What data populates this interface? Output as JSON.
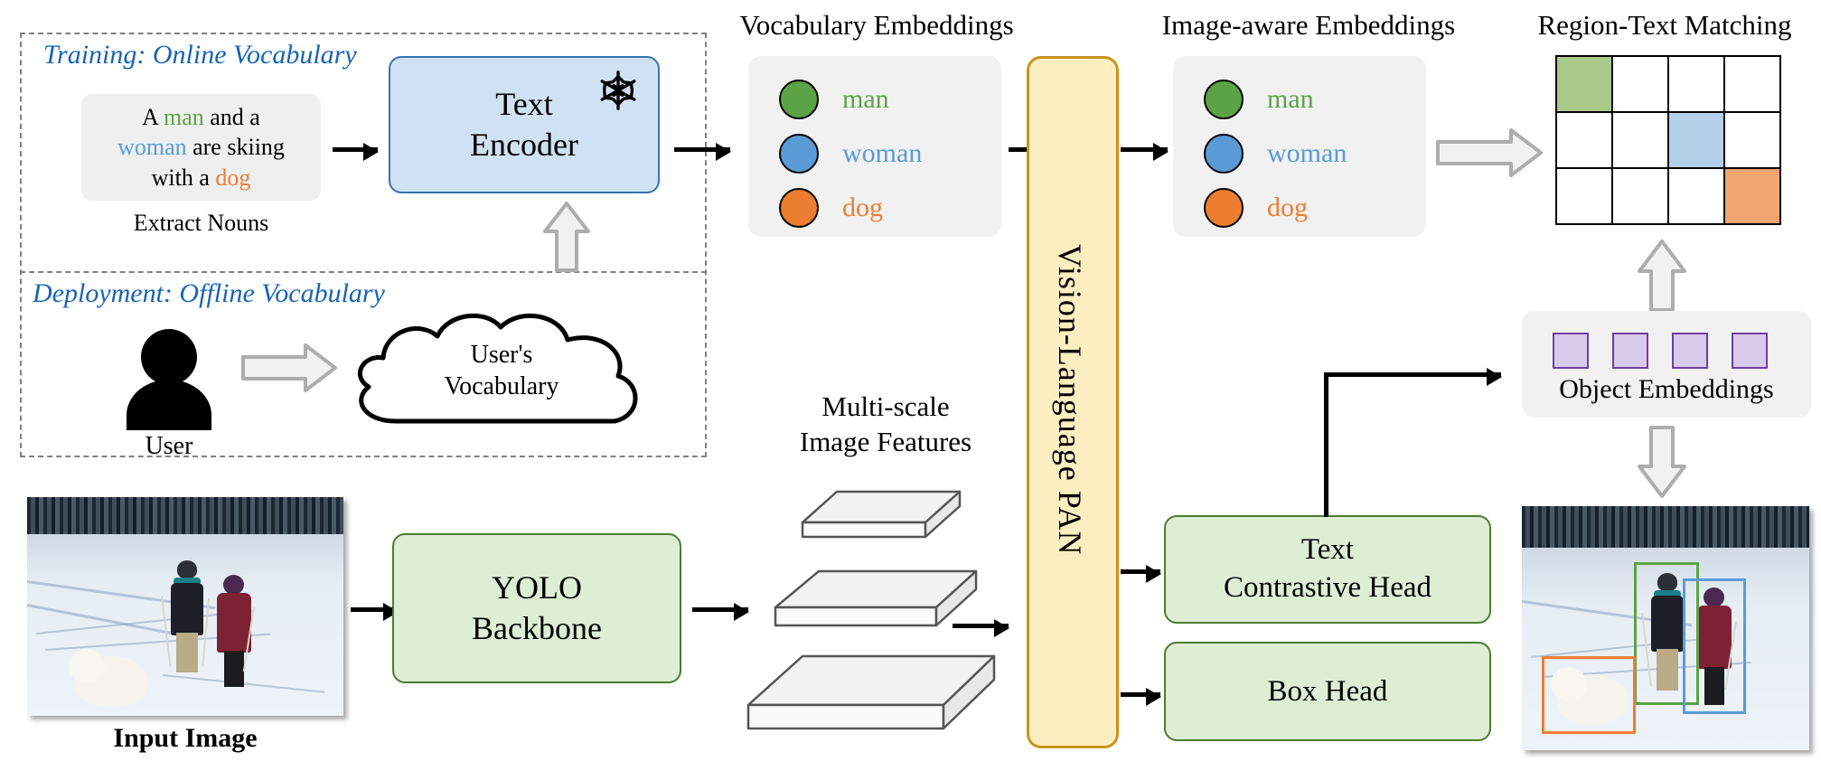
{
  "diagram": {
    "title": "YOLO-World open-vocabulary detection architecture",
    "colors": {
      "man": "#5ba345",
      "woman": "#5b9bd5",
      "dog": "#ed7d31",
      "man_cell": "#a9c98a",
      "woman_cell": "#b4cfe8",
      "dog_cell": "#f0a571",
      "section_title": "#1763b5",
      "text_encoder_fill": "#cfe2f3",
      "text_encoder_stroke": "#3a74ad",
      "pan_fill": "#fdeec2",
      "pan_stroke": "#c9951a",
      "head_fill": "#ddeed4",
      "head_stroke": "#4c7c31",
      "object_embedding_fill": "#d9c9ea",
      "object_embedding_stroke": "#6b3fa0",
      "panel_bg": "#f1f1f1"
    }
  },
  "training_section": {
    "title": "Training: Online Vocabulary",
    "caption_text": {
      "line1_pre": "A ",
      "line1_noun": "man",
      "line1_post": " and a",
      "line2_noun": "woman",
      "line2_post": " are skiing",
      "line3_pre": "with a ",
      "line3_noun": "dog"
    },
    "extract_label": "Extract Nouns"
  },
  "deployment_section": {
    "title": "Deployment: Offline Vocabulary",
    "user_label": "User",
    "cloud_line1": "User's",
    "cloud_line2": "Vocabulary"
  },
  "text_encoder": {
    "line1": "Text",
    "line2": "Encoder",
    "frozen_icon": "snowflake-icon"
  },
  "vocabulary_embeddings": {
    "header": "Vocabulary Embeddings",
    "items": [
      {
        "label": "man",
        "color": "#5ba345"
      },
      {
        "label": "woman",
        "color": "#5b9bd5"
      },
      {
        "label": "dog",
        "color": "#ed7d31"
      }
    ]
  },
  "image_aware_embeddings": {
    "header": "Image-aware Embeddings",
    "items": [
      {
        "label": "man",
        "color": "#5ba345"
      },
      {
        "label": "woman",
        "color": "#5b9bd5"
      },
      {
        "label": "dog",
        "color": "#ed7d31"
      }
    ]
  },
  "vision_language_pan": {
    "label": "Vision-Language PAN"
  },
  "region_text_matching": {
    "header": "Region-Text Matching",
    "grid": {
      "rows": 3,
      "cols": 4,
      "cells": [
        [
          "#a9c98a",
          "#ffffff",
          "#ffffff",
          "#ffffff"
        ],
        [
          "#ffffff",
          "#ffffff",
          "#b4cfe8",
          "#ffffff"
        ],
        [
          "#ffffff",
          "#ffffff",
          "#ffffff",
          "#f0a571"
        ]
      ]
    }
  },
  "object_embeddings": {
    "label": "Object Embeddings",
    "count": 4,
    "fill": "#d9c9ea",
    "stroke": "#6b3fa0"
  },
  "backbone": {
    "line1": "YOLO",
    "line2": "Backbone"
  },
  "multiscale_features": {
    "line1": "Multi-scale",
    "line2": "Image Features",
    "levels": 3
  },
  "heads": {
    "text_contrastive": {
      "line1": "Text",
      "line2": "Contrastive Head"
    },
    "box": {
      "line1": "Box Head"
    }
  },
  "input_image": {
    "caption": "Input Image",
    "scene": "two skiers and a dog in snow"
  },
  "output_image": {
    "boxes": [
      {
        "name": "man",
        "color": "#5ba345"
      },
      {
        "name": "woman",
        "color": "#5b9bd5"
      },
      {
        "name": "dog",
        "color": "#ed7d31"
      }
    ]
  }
}
